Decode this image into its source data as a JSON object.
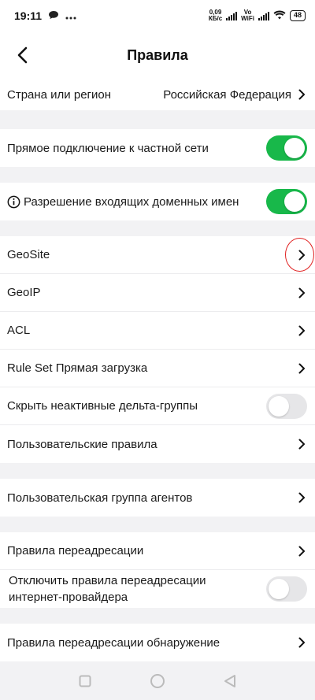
{
  "status_bar": {
    "time": "19:11",
    "net_speed_value": "0,09",
    "net_speed_unit": "КБ/с",
    "volte_label": "Vo",
    "wifi_label": "WiFi",
    "battery": "48"
  },
  "header": {
    "title": "Правила"
  },
  "country_row": {
    "label": "Страна или регион",
    "value": "Российская Федерация"
  },
  "private_network_row": {
    "label": "Прямое подключение к частной сети",
    "toggle_on": true
  },
  "incoming_domains_row": {
    "label": "Разрешение входящих доменных имен",
    "toggle_on": true
  },
  "rules_group": {
    "geosite": "GeoSite",
    "geoip": "GeoIP",
    "acl": "ACL",
    "rule_set": "Rule Set Прямая загрузка",
    "hide_inactive": "Скрыть неактивные дельта-группы",
    "hide_inactive_on": false,
    "user_rules": "Пользовательские правила"
  },
  "agent_group_row": {
    "label": "Пользовательская группа агентов"
  },
  "redirect_group": {
    "redirect_rules": "Правила переадресации",
    "disable_isp_redirect": "Отключить правила переадресации интернет-провайдера",
    "disable_isp_redirect_on": false
  },
  "redirect_detect_row": {
    "label": "Правила переадресации обнаружение"
  },
  "colors": {
    "toggle_on": "#18b84a",
    "toggle_off": "#e6e6e8",
    "highlight": "#e02020",
    "background": "#f2f2f4"
  }
}
